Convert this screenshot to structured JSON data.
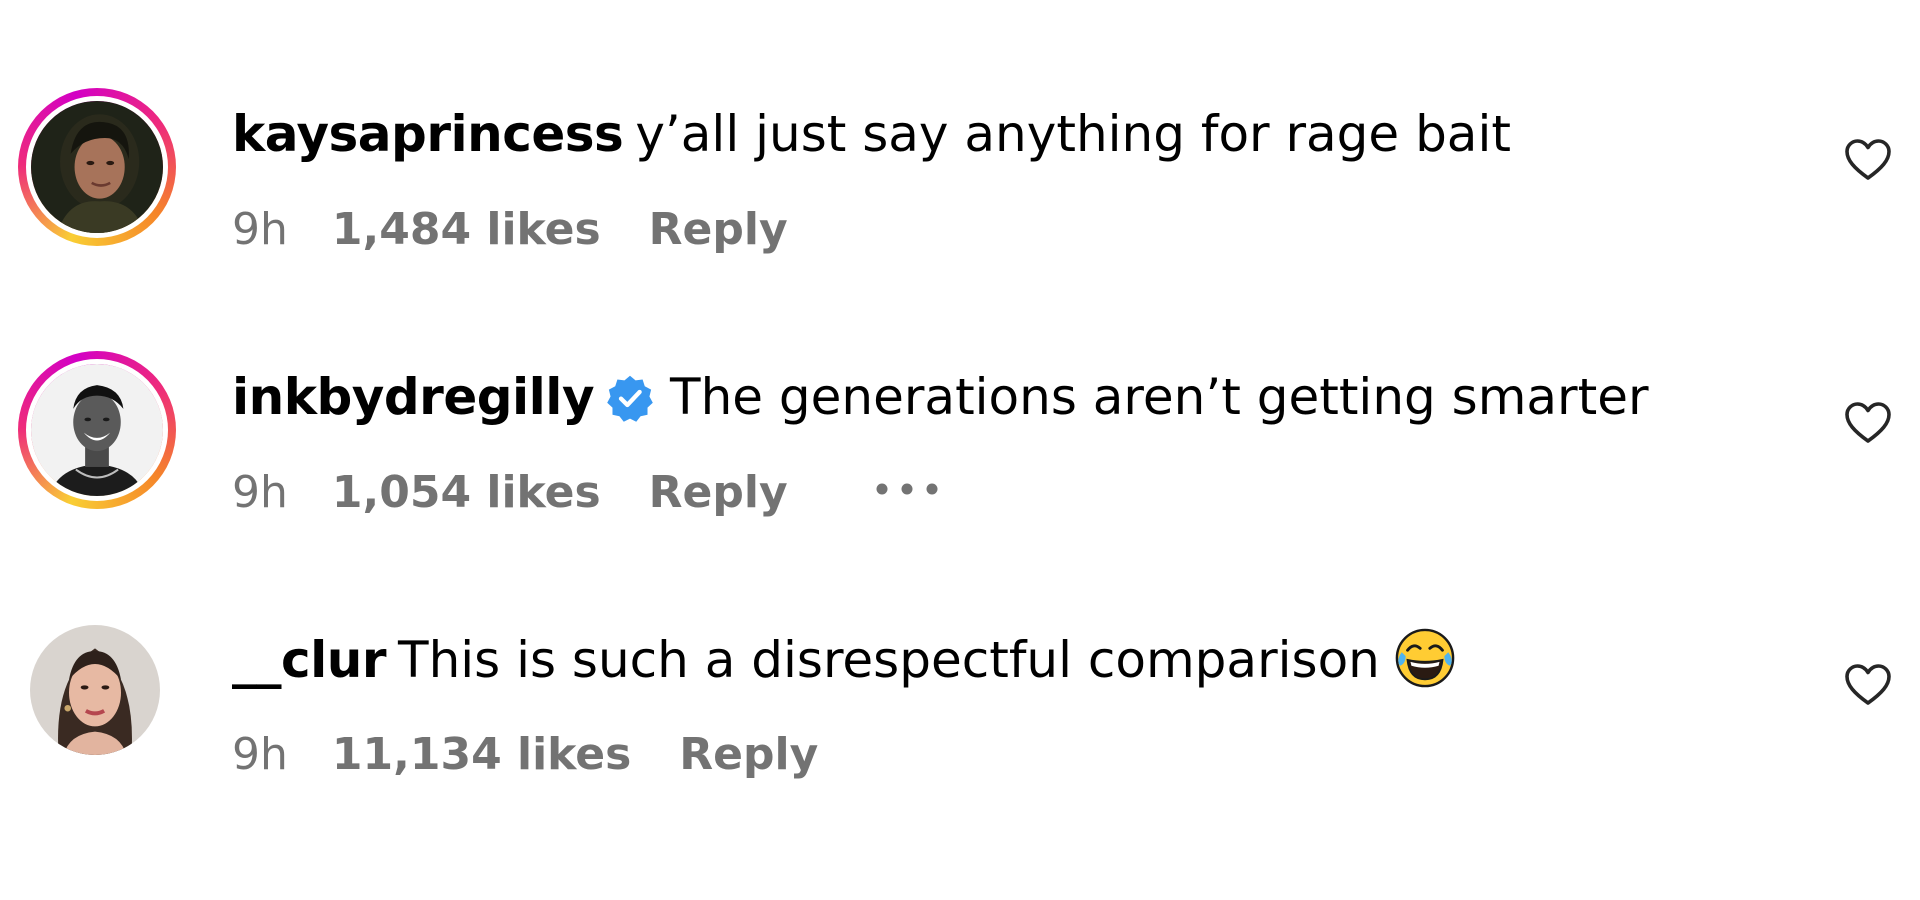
{
  "comments": [
    {
      "username": "kaysaprincess",
      "text": "y’all just say anything for rage bait",
      "time": "9h",
      "likes": "1,484 likes",
      "reply_label": "Reply",
      "verified": false,
      "story_ring": true
    },
    {
      "username": "inkbydregilly",
      "text": "The generations aren’t getting smarter",
      "time": "9h",
      "likes": "1,054 likes",
      "reply_label": "Reply",
      "verified": true,
      "story_ring": true,
      "more_options": true
    },
    {
      "username": "__clur",
      "text": "This is such a disrespectful comparison",
      "emoji": "face-with-tears-of-joy",
      "time": "9h",
      "likes": "11,134 likes",
      "reply_label": "Reply",
      "verified": false,
      "story_ring": false
    }
  ],
  "colors": {
    "text": "#000000",
    "meta": "#737373",
    "verified_badge": "#3897f0",
    "ring_start": "#f9ce34",
    "ring_mid": "#ee2a7b",
    "ring_end": "#d300c5"
  },
  "icons": {
    "like": "heart-outline-icon",
    "verified": "verified-badge-icon",
    "more": "more-options-icon"
  }
}
